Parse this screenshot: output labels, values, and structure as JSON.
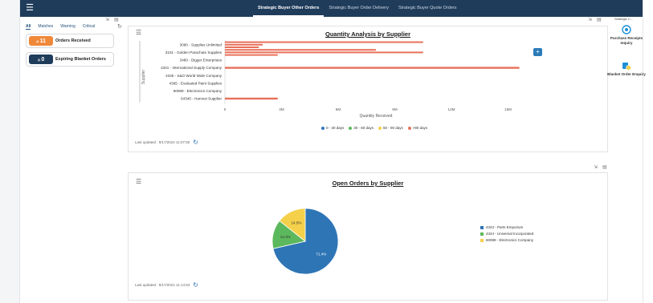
{
  "topbar": {
    "tabs": [
      {
        "label": "Strategic Buyer Other Orders",
        "active": true
      },
      {
        "label": "Strategic Buyer Order Delivery",
        "active": false
      },
      {
        "label": "Strategic Buyer Quote Orders",
        "active": false
      }
    ]
  },
  "alerts": {
    "filters": [
      "All",
      "Matches",
      "Warning",
      "Critical"
    ],
    "cards": [
      {
        "count": "11",
        "label": "Orders Received",
        "color": "#f0883a"
      },
      {
        "count": "0",
        "label": "Expiring Blanket Orders",
        "color": "#1f3c5b"
      }
    ]
  },
  "quantity_card": {
    "title": "Quantity Analysis by Supplier",
    "last_updated": "Last updated : 9/17/2024 11:07:50"
  },
  "orders_card": {
    "title": "Open Orders by Supplier",
    "last_updated": "Last updated : 9/17/2024 11:14:53"
  },
  "right_panel": {
    "title": "Strategic C...",
    "items": [
      {
        "label": "Purchase Receipts Inquiry",
        "icon": "receipts-icon"
      },
      {
        "label": "Blanket Order Enquiry",
        "icon": "blanket-order-icon"
      }
    ]
  },
  "chart_data": [
    {
      "type": "bar",
      "orientation": "horizontal",
      "title": "Quantity Analysis by Supplier",
      "xlabel": "Quantity Received",
      "ylabel": "Supplier",
      "xlim": [
        0,
        16000000
      ],
      "xticks": [
        "0",
        "3M",
        "6M",
        "9M",
        "12M",
        "15M"
      ],
      "categories": [
        "3090 - Supplies Unlimited",
        "3101 - Golden Parachute Supplies",
        "3480 - Digger Enterprises",
        "4341 - International Supply Company",
        "4345 - S&O World Wide Company",
        "4365 - Evaluated Paint Supplies",
        "60089 - Electronics Company",
        "64340 - Harvest Supplier"
      ],
      "series": [
        {
          "name": "0 - 30 days",
          "color": "#2e75b6",
          "values": [
            0,
            0,
            0,
            0,
            0,
            0,
            0,
            0
          ]
        },
        {
          "name": "30 - 60 days",
          "color": "#5cb85c",
          "values": [
            0,
            0,
            0,
            0,
            0,
            0,
            0,
            0
          ]
        },
        {
          "name": "60 - 90 days",
          "color": "#f5d04a",
          "values": [
            0,
            0,
            0,
            0,
            0,
            0,
            0,
            0
          ]
        },
        {
          "name": ">90 days",
          "color": "#e8705a",
          "values": [
            [
              10500000,
              2000000,
              1800000
            ],
            [
              8000000,
              10500000,
              2800000
            ],
            [
              0
            ],
            [
              15600000
            ],
            [
              0
            ],
            [
              0
            ],
            [
              0
            ],
            [
              2800000
            ]
          ]
        }
      ],
      "legend_position": "bottom"
    },
    {
      "type": "pie",
      "title": "Open Orders by Supplier",
      "slices": [
        {
          "label": "4343 - Parts Emporium",
          "value": 71.4,
          "display": "71.4%",
          "color": "#2e75b6"
        },
        {
          "label": "4344 - Universal Incorporated",
          "value": 14.3,
          "display": "14.3%",
          "color": "#5cb85c"
        },
        {
          "label": "60089 - Electronics Company",
          "value": 14.3,
          "display": "14.5%",
          "color": "#f5d04a"
        }
      ],
      "legend_position": "right"
    }
  ]
}
